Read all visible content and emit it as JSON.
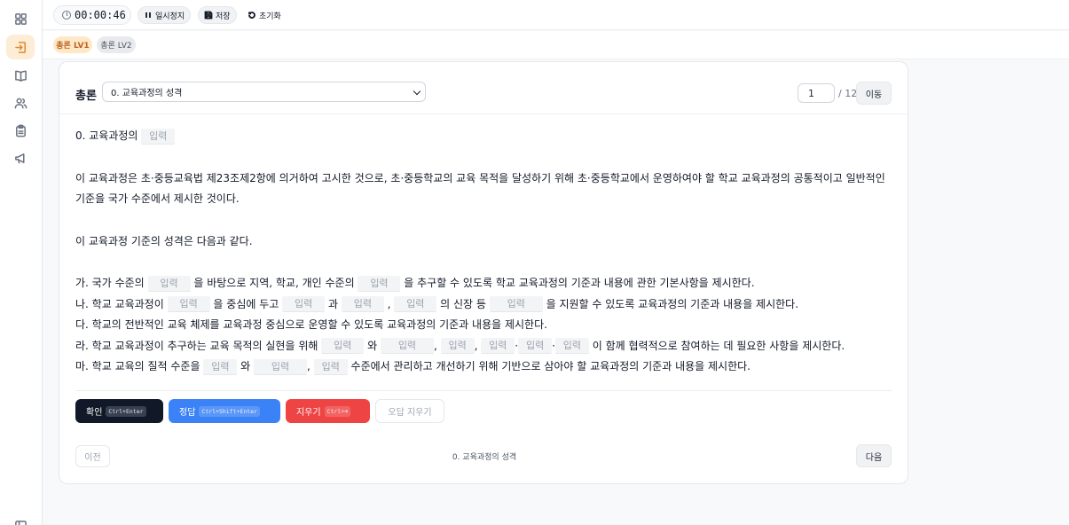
{
  "timer": {
    "value": "00:00:46"
  },
  "toolbar": {
    "pause_label": "일시정지",
    "save_label": "저장",
    "reset_label": "초기화"
  },
  "levels": [
    {
      "label": "총론 LV1",
      "active": true
    },
    {
      "label": "총론 LV2",
      "active": false
    }
  ],
  "card": {
    "section_label": "총론",
    "select_value": "0. 교육과정의 성격",
    "page_current": "1",
    "page_total": "/ 12",
    "move_label": "이동"
  },
  "content": {
    "title_prefix": "0. 교육과정의",
    "blank_placeholder": "입력",
    "para1": "이 교육과정은 초·중등교육법 제23조제2항에 의거하여 고시한 것으로, 초·중등학교의 교육 목적을 달성하기 위해 초·중등학교에서 운영하여야 할 학교 교육과정의 공통적이고 일반적인 기준을 국가 수준에서 제시한 것이다.",
    "para2": "이 교육과정 기준의 성격은 다음과 같다.",
    "ga": {
      "t1": "가. 국가 수준의",
      "t2": "을 바탕으로 지역, 학교, 개인 수준의",
      "t3": "을 추구할 수 있도록 학교 교육과정의 기준과 내용에 관한 기본사항을 제시한다."
    },
    "na": {
      "t1": "나. 학교 교육과정이",
      "t2": "을 중심에 두고",
      "t3": "과",
      "t4": ",",
      "t5": "의 신장 등",
      "t6": "을 지원할 수 있도록 교육과정의 기준과 내용을 제시한다."
    },
    "da": "다. 학교의 전반적인 교육 체제를 교육과정 중심으로 운영할 수 있도록 교육과정의 기준과 내용을 제시한다.",
    "ra": {
      "t1": "라. 학교 교육과정이 추구하는 교육 목적의 실현을 위해",
      "t2": "와",
      "t3": ",",
      "t4": ",",
      "t5": "·",
      "t6": "·",
      "t7": "이 함께 협력적으로 참여하는 데 필요한 사항을 제시한다."
    },
    "ma": {
      "t1": "마. 학교 교육의 질적 수준을",
      "t2": "와",
      "t3": ",",
      "t4": "수준에서 관리하고 개선하기 위해 기반으로 삼아야 할 교육과정의 기준과 내용을 제시한다."
    }
  },
  "actions": {
    "confirm_label": "확인",
    "confirm_kbd": "Ctrl+Enter",
    "answer_label": "정답",
    "answer_kbd": "Ctrl+Shift+Enter",
    "clear_label": "지우기",
    "clear_kbd": "Ctrl+⌫",
    "clear_wrong_label": "오답 지우기"
  },
  "footer": {
    "prev_label": "이전",
    "title": "0. 교육과정의 성격",
    "next_label": "다음"
  }
}
